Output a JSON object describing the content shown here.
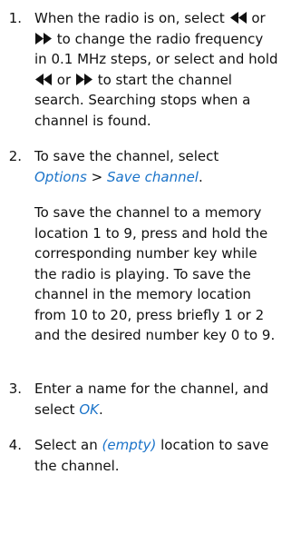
{
  "steps": [
    {
      "number": "1.",
      "lines": {
        "l1_before": "When the radio is on, select",
        "l1_after": "or",
        "l2_after": "to change the radio frequency",
        "l3": "in 0.1 MHz steps, or select and hold",
        "l4_mid": "or",
        "l4_after": "to start the channel",
        "l5": "search. Searching stops when a",
        "l6": "channel is found."
      }
    },
    {
      "number": "2.",
      "lines": {
        "l1": "To save the channel, select",
        "link_options": "Options",
        "separator": ">",
        "link_save": "Save channel",
        "period": "."
      },
      "note_lines": [
        "To save the channel to a memory",
        "location 1 to 9, press and hold the",
        "corresponding number key while",
        "the radio is playing. To save the",
        "channel in the memory location",
        "from 10 to 20, press briefly 1 or 2",
        "and the desired number key 0 to 9."
      ]
    },
    {
      "number": "3.",
      "lines": {
        "l1": "Enter a name for the channel, and",
        "l2_before": "select",
        "link_ok": "OK",
        "period": "."
      }
    },
    {
      "number": "4.",
      "lines": {
        "l1_before": "Select an",
        "link_empty": "(empty)",
        "l1_after": "location to save",
        "l2": "the channel."
      }
    }
  ],
  "icons": {
    "rewind": "rewind-icon",
    "forward": "fast-forward-icon"
  },
  "colors": {
    "text": "#111111",
    "link": "#1a73c9",
    "background": "#ffffff"
  }
}
